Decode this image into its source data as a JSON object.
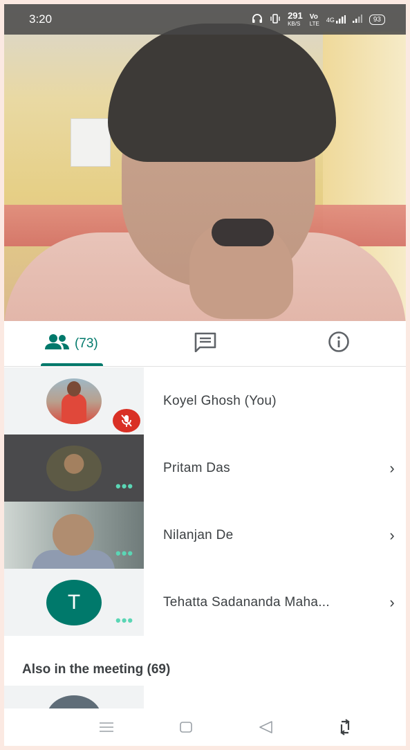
{
  "status_bar": {
    "time": "3:20",
    "net_speed": "291",
    "net_unit": "KB/S",
    "volte": "Vo",
    "volte_sub": "LTE",
    "network": "4G",
    "battery": "93"
  },
  "tabs": {
    "people_count": "(73)"
  },
  "participants": [
    {
      "name": "Koyel Ghosh (You)",
      "muted": true,
      "chevron": ""
    },
    {
      "name": "Pritam Das",
      "chevron": "›"
    },
    {
      "name": "Nilanjan De",
      "chevron": "›"
    },
    {
      "name": "Tehatta Sadananda Maha...",
      "initial": "T",
      "chevron": "›"
    }
  ],
  "also_in_meeting": "Also in the meeting (69)",
  "more_dots": "•••",
  "colors": {
    "accent": "#00796b",
    "muted_red": "#d93025",
    "dots": "#5bd6b5"
  }
}
